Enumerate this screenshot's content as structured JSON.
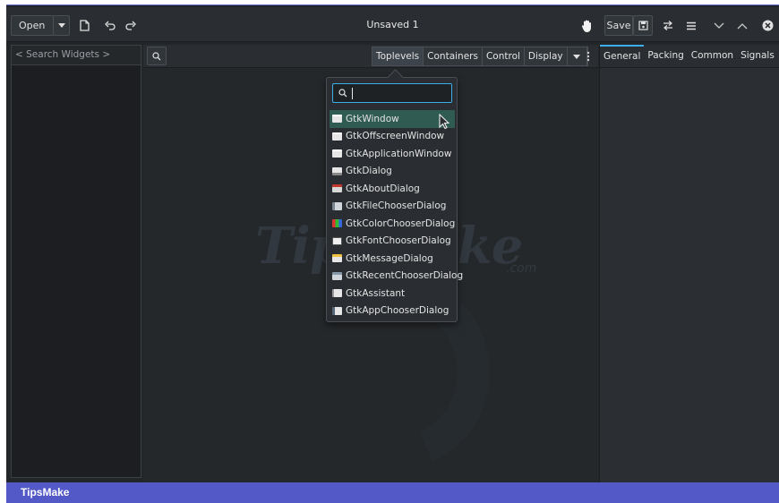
{
  "window": {
    "title": "Unsaved 1",
    "open_label": "Open",
    "save_label": "Save"
  },
  "left_pane": {
    "search_placeholder": "< Search Widgets >"
  },
  "palette": {
    "tabs": [
      "Toplevels",
      "Containers",
      "Control",
      "Display"
    ],
    "active_tab": "Toplevels"
  },
  "properties": {
    "tabs": [
      "General",
      "Packing",
      "Common",
      "Signals"
    ],
    "active_tab": "General"
  },
  "popover": {
    "search_value": "",
    "items": [
      {
        "label": "GtkWindow",
        "icon": "window-icon",
        "selected": true
      },
      {
        "label": "GtkOffscreenWindow",
        "icon": "window-icon",
        "selected": false
      },
      {
        "label": "GtkApplicationWindow",
        "icon": "window-icon",
        "selected": false
      },
      {
        "label": "GtkDialog",
        "icon": "dialog-icon",
        "selected": false
      },
      {
        "label": "GtkAboutDialog",
        "icon": "about-dialog-icon",
        "selected": false
      },
      {
        "label": "GtkFileChooserDialog",
        "icon": "file-chooser-icon",
        "selected": false
      },
      {
        "label": "GtkColorChooserDialog",
        "icon": "color-chooser-icon",
        "selected": false
      },
      {
        "label": "GtkFontChooserDialog",
        "icon": "font-chooser-icon",
        "selected": false
      },
      {
        "label": "GtkMessageDialog",
        "icon": "message-dialog-icon",
        "selected": false
      },
      {
        "label": "GtkRecentChooserDialog",
        "icon": "recent-chooser-icon",
        "selected": false
      },
      {
        "label": "GtkAssistant",
        "icon": "assistant-icon",
        "selected": false
      },
      {
        "label": "GtkAppChooserDialog",
        "icon": "app-chooser-icon",
        "selected": false
      }
    ]
  },
  "watermark": {
    "text": "TipsMake",
    "suffix": ".com"
  },
  "footer": {
    "label": "TipsMake"
  },
  "colors": {
    "accent": "#3daee9",
    "selection": "#2f5b52",
    "footer": "#5359c7"
  }
}
